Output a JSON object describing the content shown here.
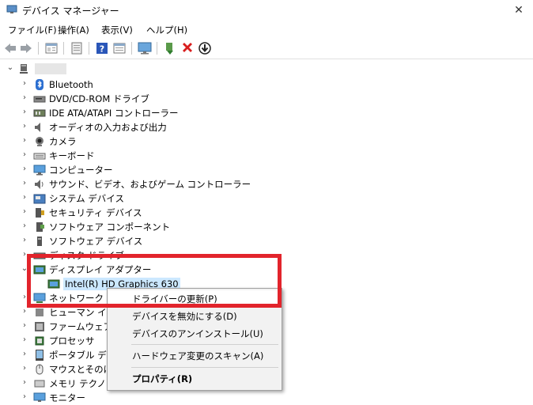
{
  "window": {
    "title": "デバイス マネージャー",
    "close_glyph": "✕"
  },
  "menubar": [
    "ファイル(F)",
    "操作(A)",
    "表示(V)",
    "ヘルプ(H)"
  ],
  "toolbar": {
    "buttons": [
      "back-icon",
      "forward-icon",
      "properties-icon",
      "update-driver-icon",
      "help-icon",
      "show-hide-console-tree-icon",
      "monitor-icon",
      "enable-device-icon",
      "uninstall-icon",
      "scan-hardware-icon"
    ]
  },
  "tree": {
    "root_label": "",
    "categories": [
      "Bluetooth",
      "DVD/CD-ROM ドライブ",
      "IDE ATA/ATAPI コントローラー",
      "オーディオの入力および出力",
      "カメラ",
      "キーボード",
      "コンピューター",
      "サウンド、ビデオ、およびゲーム コントローラー",
      "システム デバイス",
      "セキュリティ デバイス",
      "ソフトウェア コンポーネント",
      "ソフトウェア デバイス",
      "ディスク ドライブ",
      "ディスプレイ アダプター",
      "Intel(R) HD Graphics 630",
      "ネットワーク アダプター",
      "ヒューマン インターフェイス デバイス",
      "ファームウェア",
      "プロセッサ",
      "ポータブル デバイス",
      "マウスとそのほかのポインティング デバイス",
      "メモリ テクノロジ デバイス",
      "モニター"
    ]
  },
  "context_menu": {
    "items": [
      "ドライバーの更新(P)",
      "デバイスを無効にする(D)",
      "デバイスのアンインストール(U)",
      "ハードウェア変更のスキャン(A)",
      "プロパティ(R)"
    ]
  },
  "colors": {
    "highlight_box": "#e2242c",
    "selection": "#cce8ff",
    "accent": "#0078d7"
  }
}
